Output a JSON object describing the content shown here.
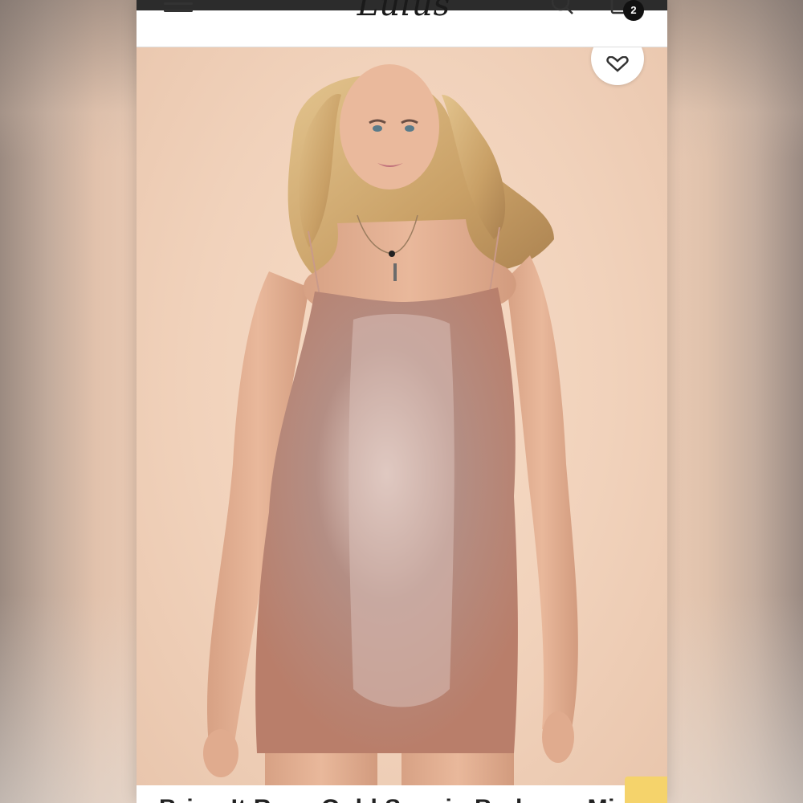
{
  "header": {
    "logo_text": "Lulus",
    "cart_count": "2",
    "icons": [
      "menu-icon",
      "search-icon",
      "shopping-bag-icon"
    ]
  },
  "hero": {
    "image_description": "Model wearing a rose gold sequin bodycon mini dress",
    "favorite_icon": "heart-icon",
    "carousel": {
      "total": 5,
      "active_index": 0
    }
  },
  "product": {
    "title": "Bring It Rose Gold Sequin Bodycon Mi"
  },
  "colors": {
    "header_bg": "#ffffff",
    "hero_bg": "#f1d2bb",
    "dress": "#c99a8a",
    "chat_tab": "#f5d36b"
  }
}
